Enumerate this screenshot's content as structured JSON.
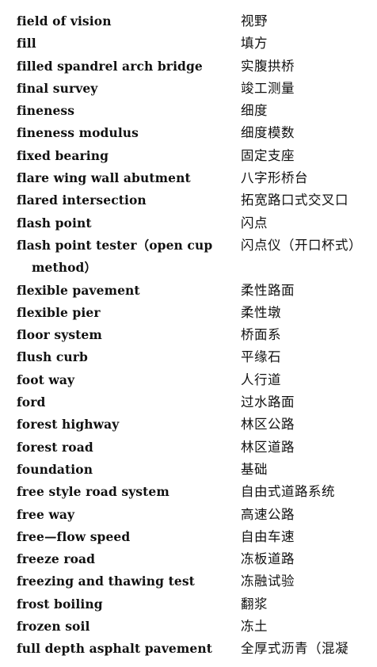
{
  "entries": [
    {
      "en": "field of vision",
      "zh": "视野"
    },
    {
      "en": "fill",
      "zh": "填方"
    },
    {
      "en": "filled spandrel arch bridge",
      "zh": "实腹拱桥"
    },
    {
      "en": "final survey",
      "zh": "竣工测量"
    },
    {
      "en": "fineness",
      "zh": "细度"
    },
    {
      "en": "fineness modulus",
      "zh": "细度模数"
    },
    {
      "en": "fixed bearing",
      "zh": "固定支座"
    },
    {
      "en": "flare wing wall abutment",
      "zh": "八字形桥台"
    },
    {
      "en": "flared intersection",
      "zh": "拓宽路口式交叉口"
    },
    {
      "en": "flash point",
      "zh": "闪点"
    },
    {
      "en": "flash point tester（open cup method）",
      "zh": "闪点仪（开口杯式）"
    },
    {
      "en": "flexible pavement",
      "zh": "柔性路面"
    },
    {
      "en": "flexible pier",
      "zh": "柔性墩"
    },
    {
      "en": "floor system",
      "zh": "桥面系"
    },
    {
      "en": "flush curb",
      "zh": "平缘石"
    },
    {
      "en": "foot way",
      "zh": "人行道"
    },
    {
      "en": "ford",
      "zh": "过水路面"
    },
    {
      "en": "forest highway",
      "zh": "林区公路"
    },
    {
      "en": "forest road",
      "zh": "林区道路"
    },
    {
      "en": "foundation",
      "zh": "基础"
    },
    {
      "en": "free style road system",
      "zh": "自由式道路系统"
    },
    {
      "en": "free way",
      "zh": "高速公路"
    },
    {
      "en": "free—flow speed",
      "zh": "自由车速"
    },
    {
      "en": "freeze road",
      "zh": "冻板道路"
    },
    {
      "en": "freezing and thawing test",
      "zh": "冻融试验"
    },
    {
      "en": "frost boiling",
      "zh": "翻浆"
    },
    {
      "en": "frozen soil",
      "zh": "冻土"
    },
    {
      "en": "full depth asphalt pavement",
      "zh": "全厚式沥青（混凝"
    }
  ]
}
